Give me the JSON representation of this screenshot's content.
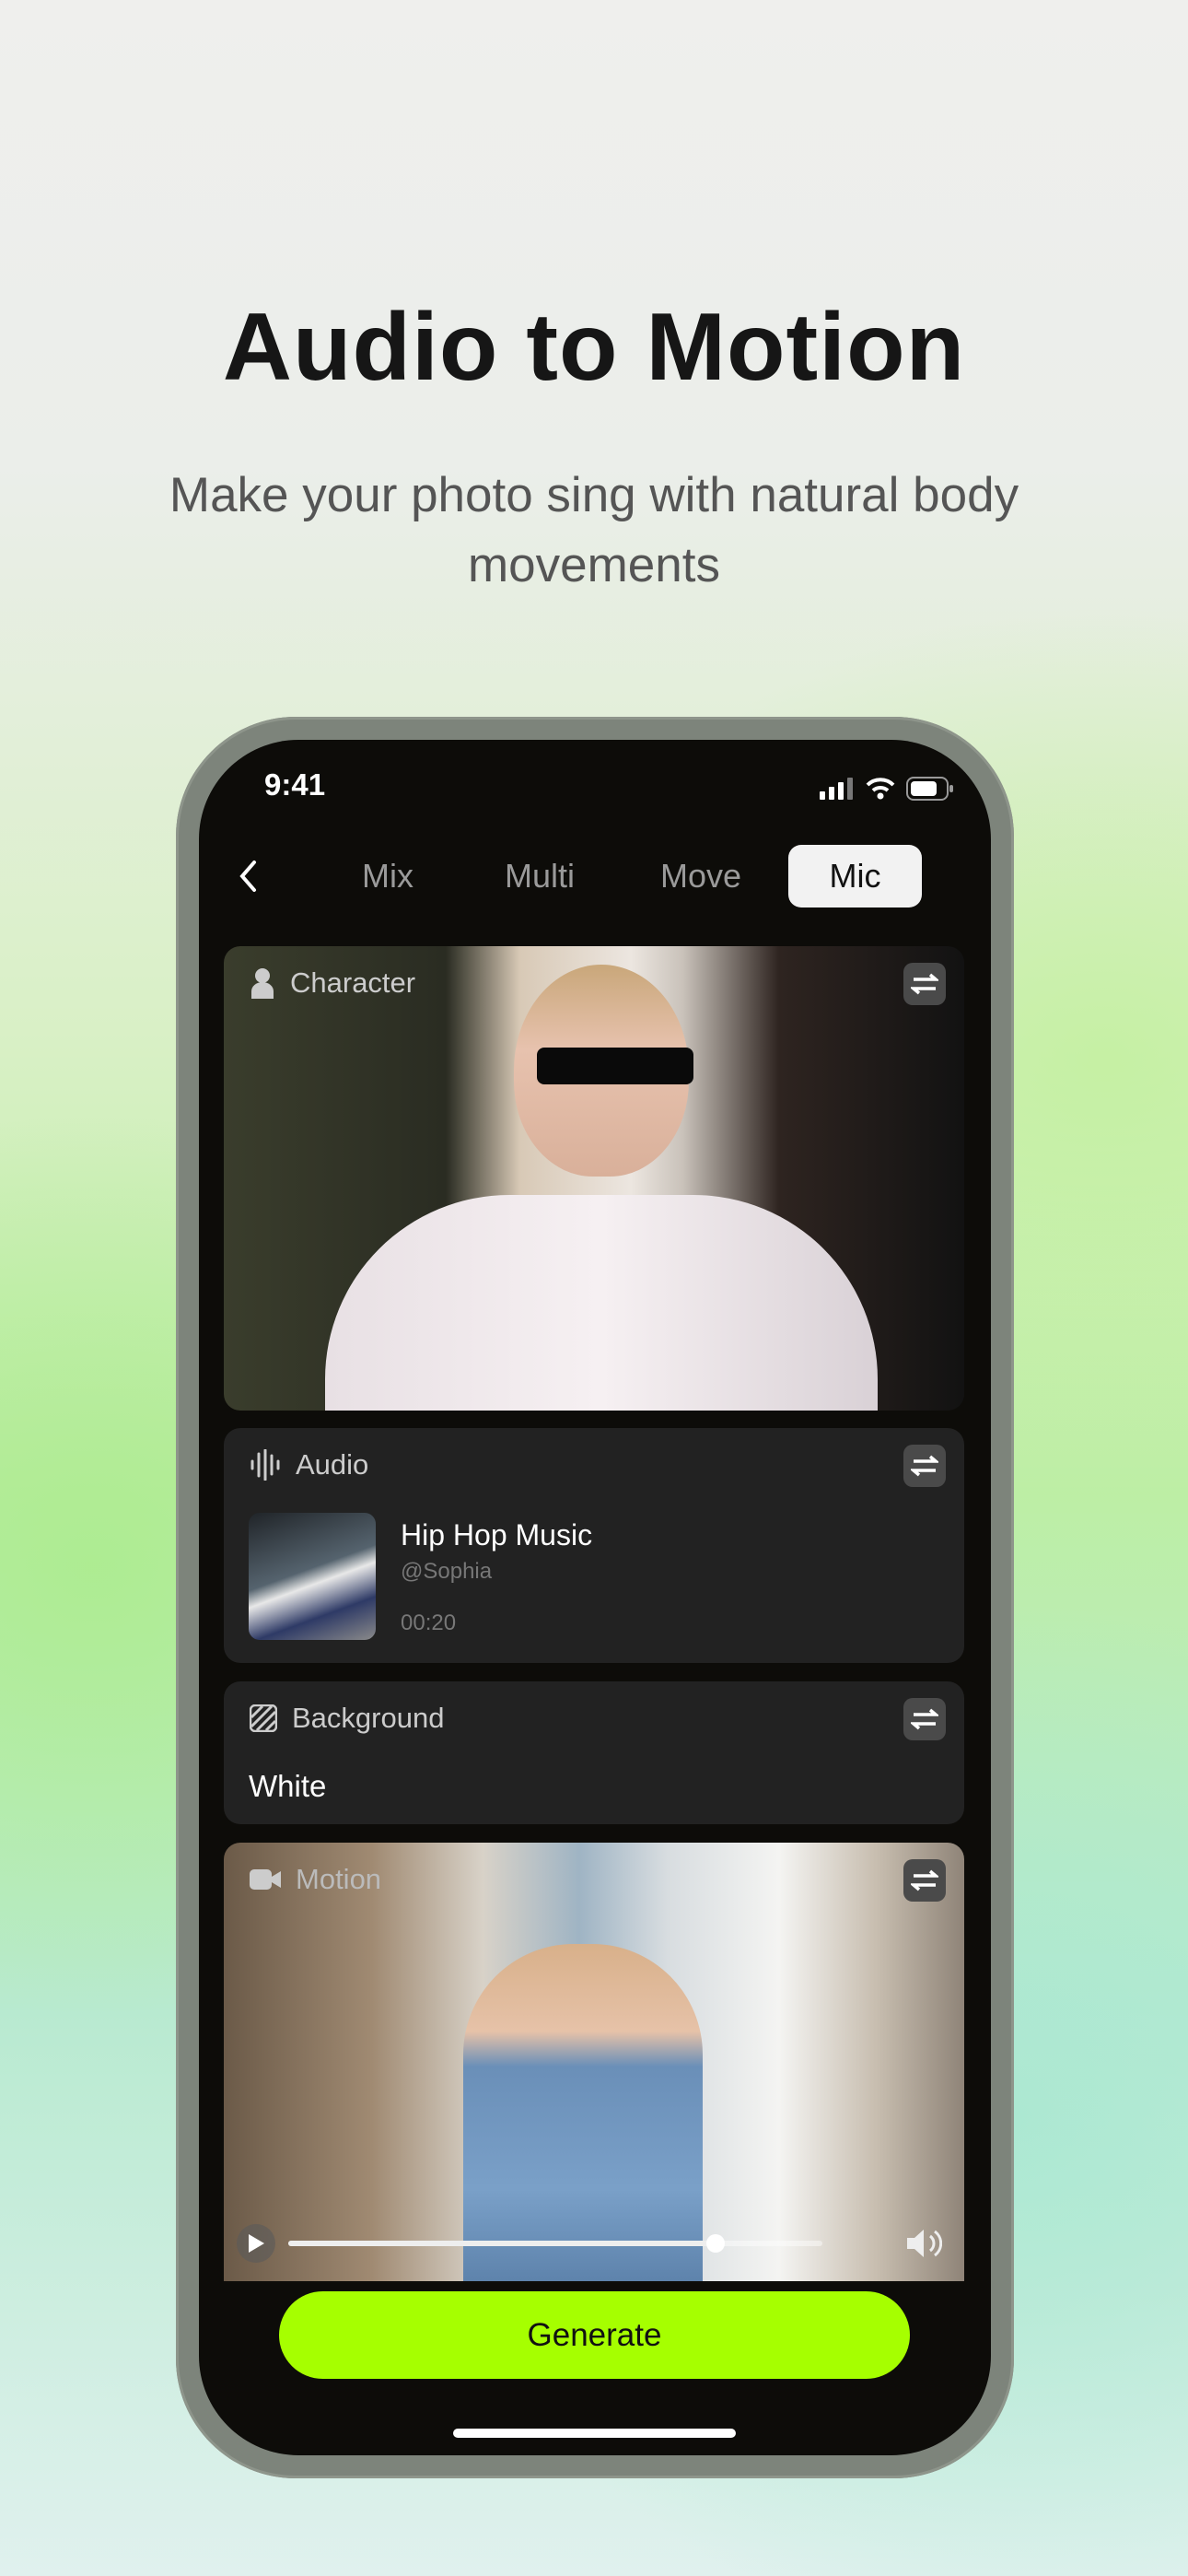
{
  "promo": {
    "title": "Audio to Motion",
    "subtitle": "Make your photo sing with natural body movements"
  },
  "status_bar": {
    "time": "9:41",
    "icons": [
      "signal-icon",
      "wifi-icon",
      "battery-icon"
    ]
  },
  "nav": {
    "back_icon": "chevron-left-icon",
    "tabs": [
      {
        "label": "Mix"
      },
      {
        "label": "Multi"
      },
      {
        "label": "Move"
      },
      {
        "label": "Mic",
        "active": true
      }
    ]
  },
  "character": {
    "label": "Character",
    "icon": "person-icon"
  },
  "audio": {
    "label": "Audio",
    "icon": "waveform-icon",
    "track_title": "Hip Hop Music",
    "artist": "@Sophia",
    "duration": "00:20"
  },
  "background": {
    "label": "Background",
    "icon": "hatch-icon",
    "value": "White"
  },
  "motion": {
    "label": "Motion",
    "icon": "video-camera-icon",
    "progress": 0.8
  },
  "generate_label": "Generate",
  "colors": {
    "accent": "#a6ff00",
    "screen": "#0d0c09",
    "card": "#222222"
  }
}
